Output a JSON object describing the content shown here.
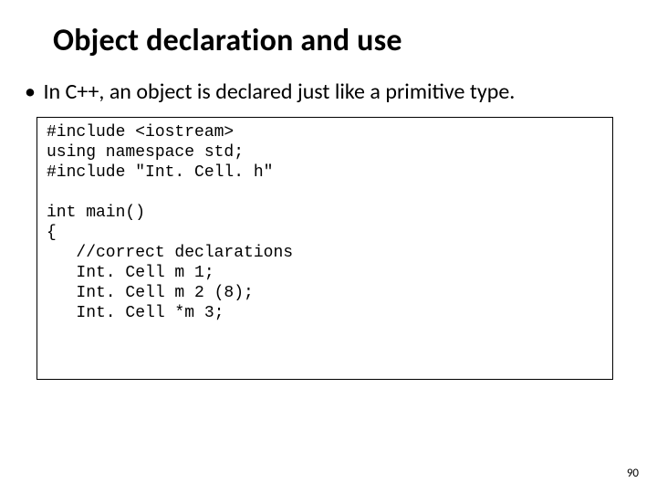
{
  "title": "Object declaration and use",
  "bullet": {
    "marker": "•",
    "text": "In C++, an object is declared just like a primitive type."
  },
  "code": {
    "l1": "#include <iostream>",
    "l2": "using namespace std;",
    "l3": "#include \"Int. Cell. h\"",
    "blank": "",
    "l4": "int main()",
    "l5": "{",
    "l6": "   //correct declarations",
    "l7": "   Int. Cell m 1;",
    "l8": "   Int. Cell m 2 (8);",
    "l9": "   Int. Cell *m 3;"
  },
  "page_number": "90"
}
